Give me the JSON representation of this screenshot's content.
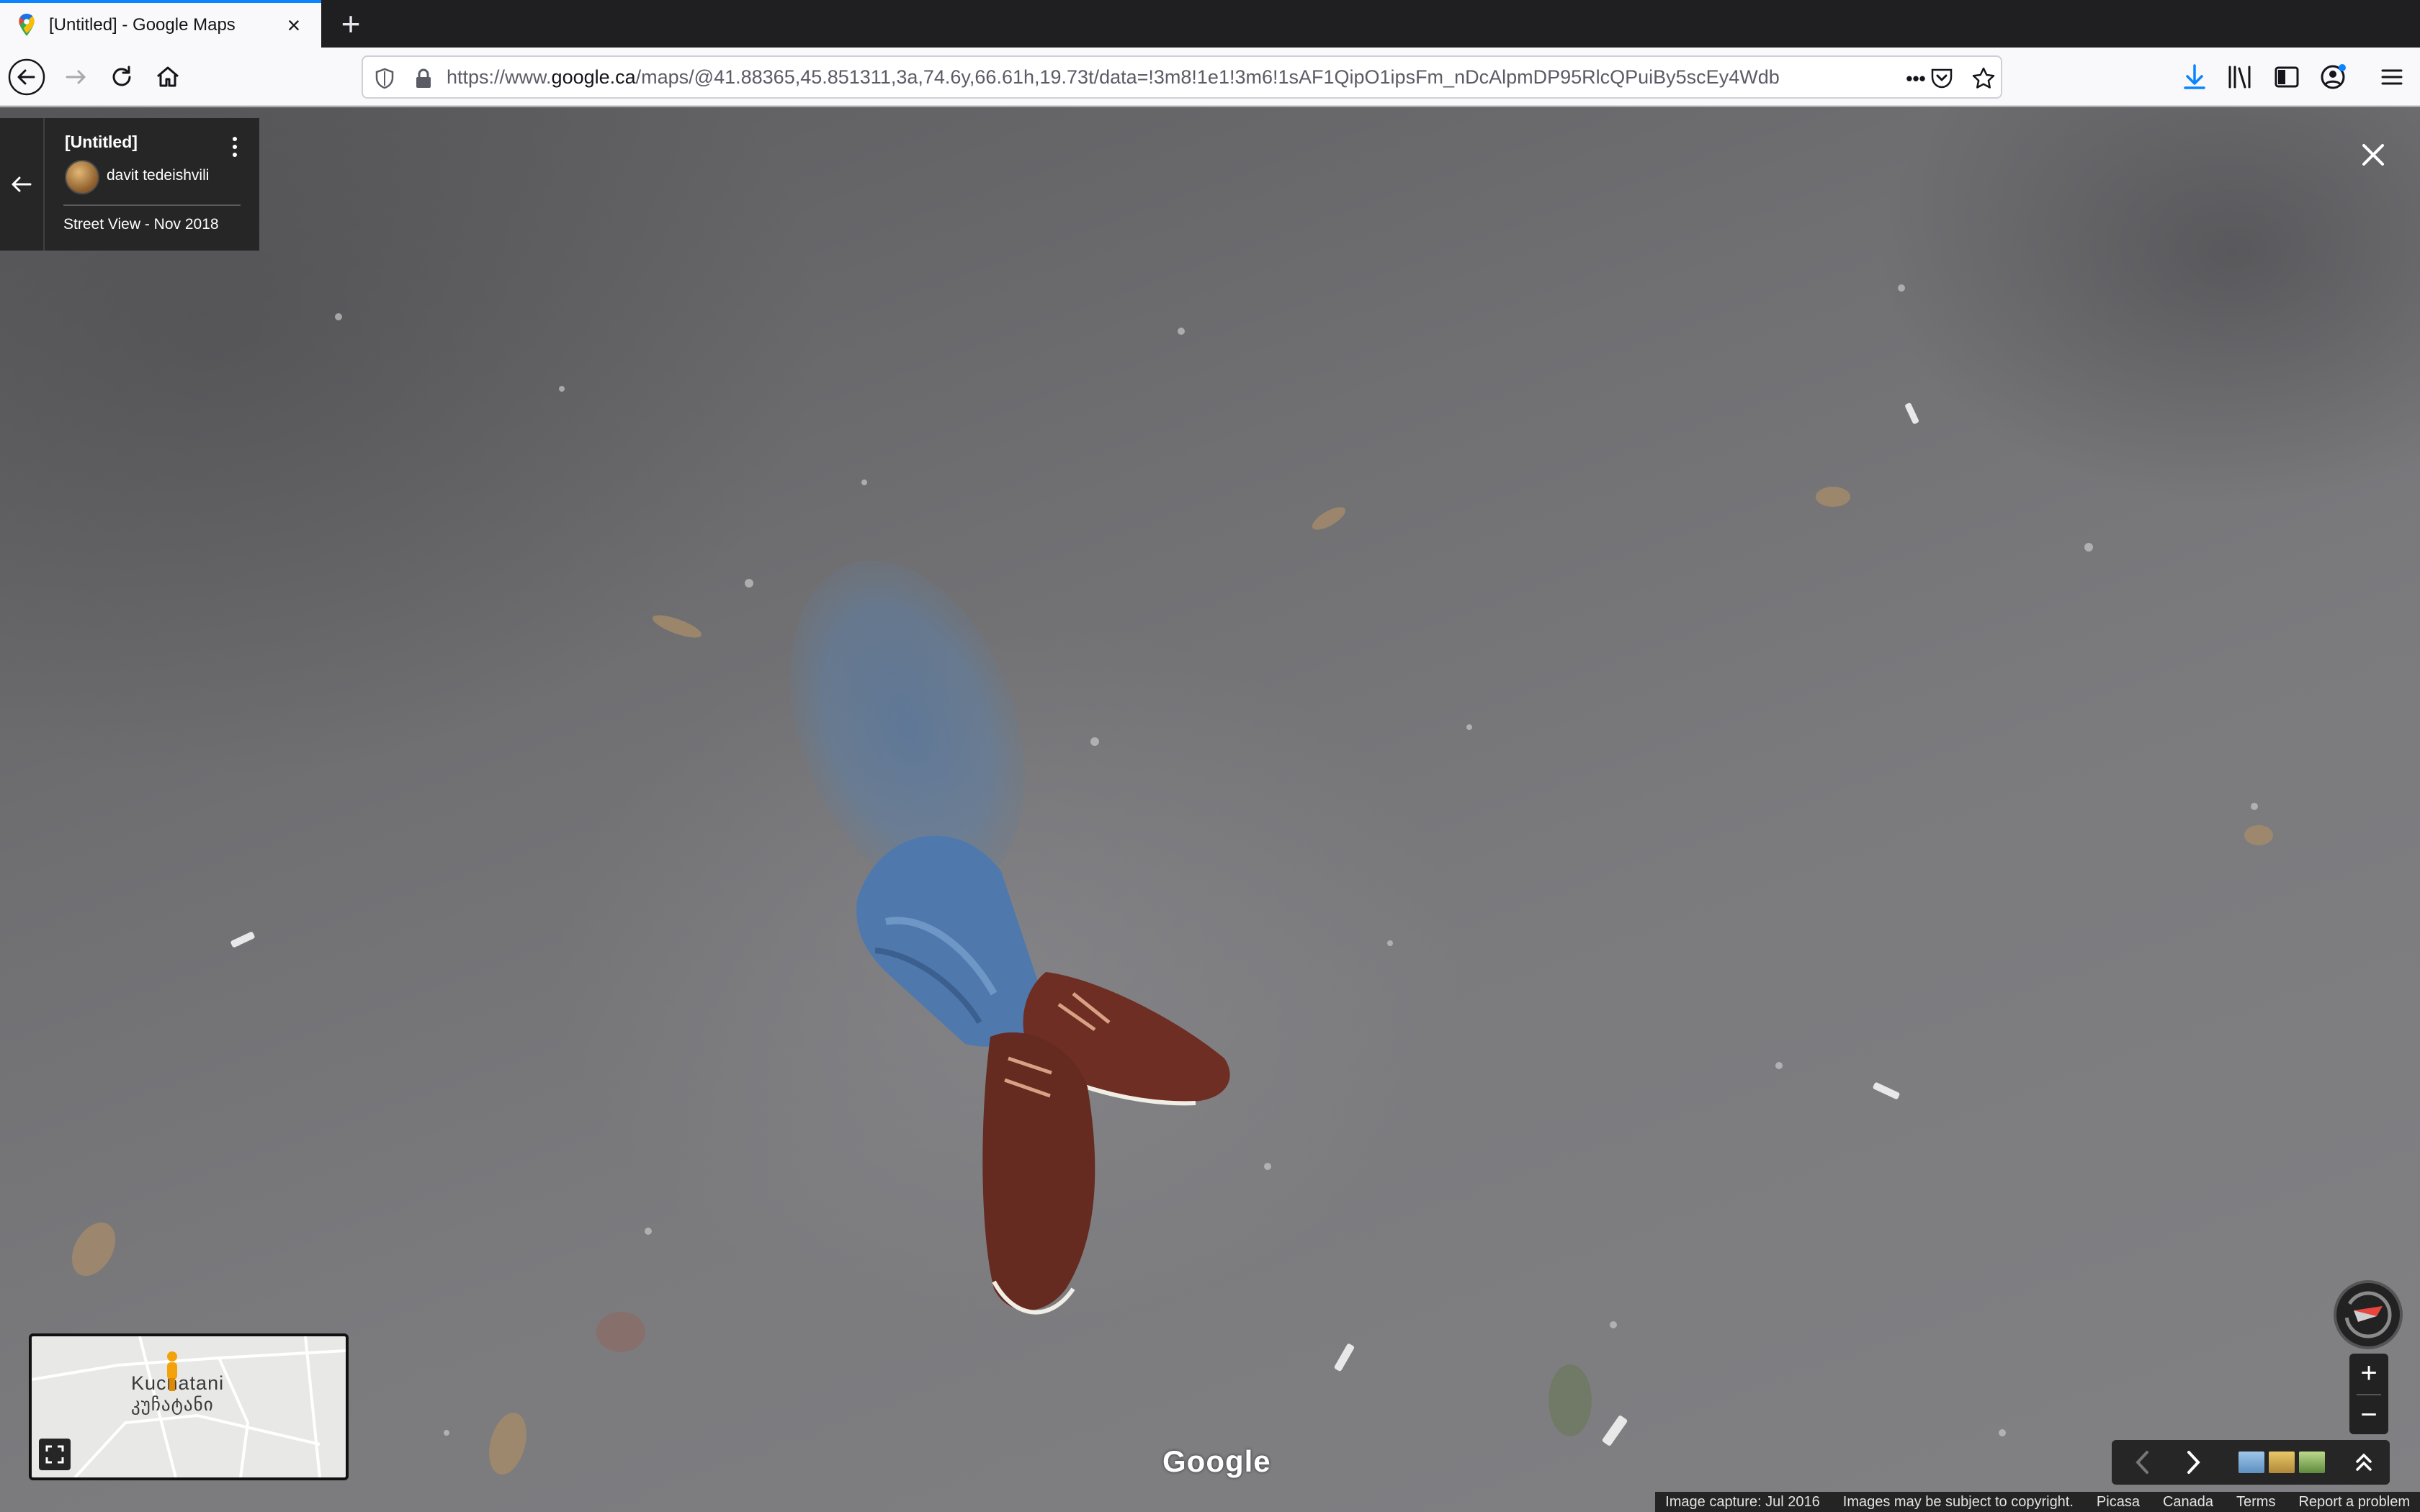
{
  "browser": {
    "tab_title": "[Untitled] - Google Maps",
    "new_tab_symbol": "+",
    "url_prefix": "https://www.",
    "url_domain": "google.ca",
    "url_path": "/maps/@41.88365,45.851311,3a,74.6y,66.61h,19.73t/data=!3m8!1e1!3m6!1sAF1QipO1ipsFm_nDcAlpmDP95RlcQPuiBy5scEy4Wdb",
    "page_actions_symbol": "•••"
  },
  "photo_card": {
    "title": "[Untitled]",
    "author": "davit tedeishvili",
    "date": "Street View - Nov 2018"
  },
  "minimap": {
    "place_latin": "Kuchatani",
    "place_georgian": "კუჩატანი"
  },
  "zoom": {
    "in": "+",
    "out": "−"
  },
  "watermark": "Google",
  "footer": {
    "capture": "Image capture: Jul 2016",
    "copyright": "Images may be subject to copyright.",
    "picasa": "Picasa",
    "country": "Canada",
    "terms": "Terms",
    "report": "Report a problem"
  },
  "colors": {
    "accent_tab": "#0a84ff",
    "download_icon": "#0a84ff",
    "compass_needle": "#e8453c"
  }
}
